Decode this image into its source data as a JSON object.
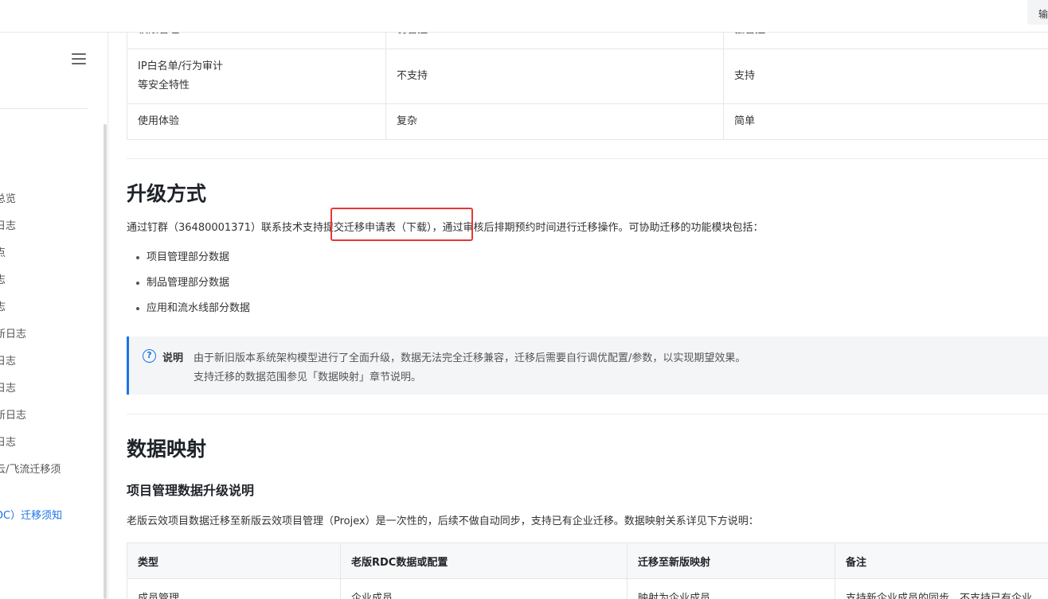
{
  "topbar": {
    "button_label": "输"
  },
  "sidebar": {
    "items": [
      {
        "label": "总览"
      },
      {
        "label": "日志"
      },
      {
        "label": "点"
      },
      {
        "label": "志"
      },
      {
        "label": "志"
      },
      {
        "label": "新日志"
      },
      {
        "label": "日志"
      },
      {
        "label": "日志"
      },
      {
        "label": "新日志"
      },
      {
        "label": "日志"
      },
      {
        "label": "云/飞流迁移须"
      },
      {
        "label": "DC）迁移须知",
        "active": true
      }
    ]
  },
  "compare_table": {
    "rows": [
      {
        "feature": "权限管理",
        "old": "弱管控",
        "new": "强管控"
      },
      {
        "feature_line1": "IP白名单/行为审计",
        "feature_line2": "等安全特性",
        "old": "不支持",
        "new": "支持"
      },
      {
        "feature": "使用体验",
        "old": "复杂",
        "new": "简单"
      }
    ]
  },
  "upgrade": {
    "heading": "升级方式",
    "intro": "通过钉群（36480001371）联系技术支持提交迁移申请表（下载），通过审核后排期预约时间进行迁移操作。可协助迁移的功能模块包括：",
    "bullets": [
      "项目管理部分数据",
      "制品管理部分数据",
      "应用和流水线部分数据"
    ]
  },
  "note": {
    "icon": "question-circle-icon",
    "title": "说明",
    "line1": "由于新旧版本系统架构模型进行了全面升级，数据无法完全迁移兼容，迁移后需要自行调优配置/参数，以实现期望效果。",
    "line2": "支持迁移的数据范围参见「数据映射」章节说明。"
  },
  "mapping": {
    "heading": "数据映射",
    "subheading": "项目管理数据升级说明",
    "desc": "老版云效项目数据迁移至新版云效项目管理（Projex）是一次性的，后续不做自动同步，支持已有企业迁移。数据映射关系详见下方说明：",
    "headers": [
      "类型",
      "老版RDC数据或配置",
      "迁移至新版映射",
      "备注"
    ],
    "rows": [
      [
        "成员管理",
        "企业成员",
        "映射为企业成员",
        "支持新企业成员的同步，不支持已有企业"
      ]
    ]
  },
  "colors": {
    "accent": "#1a73e8",
    "highlight": "#e53935"
  }
}
